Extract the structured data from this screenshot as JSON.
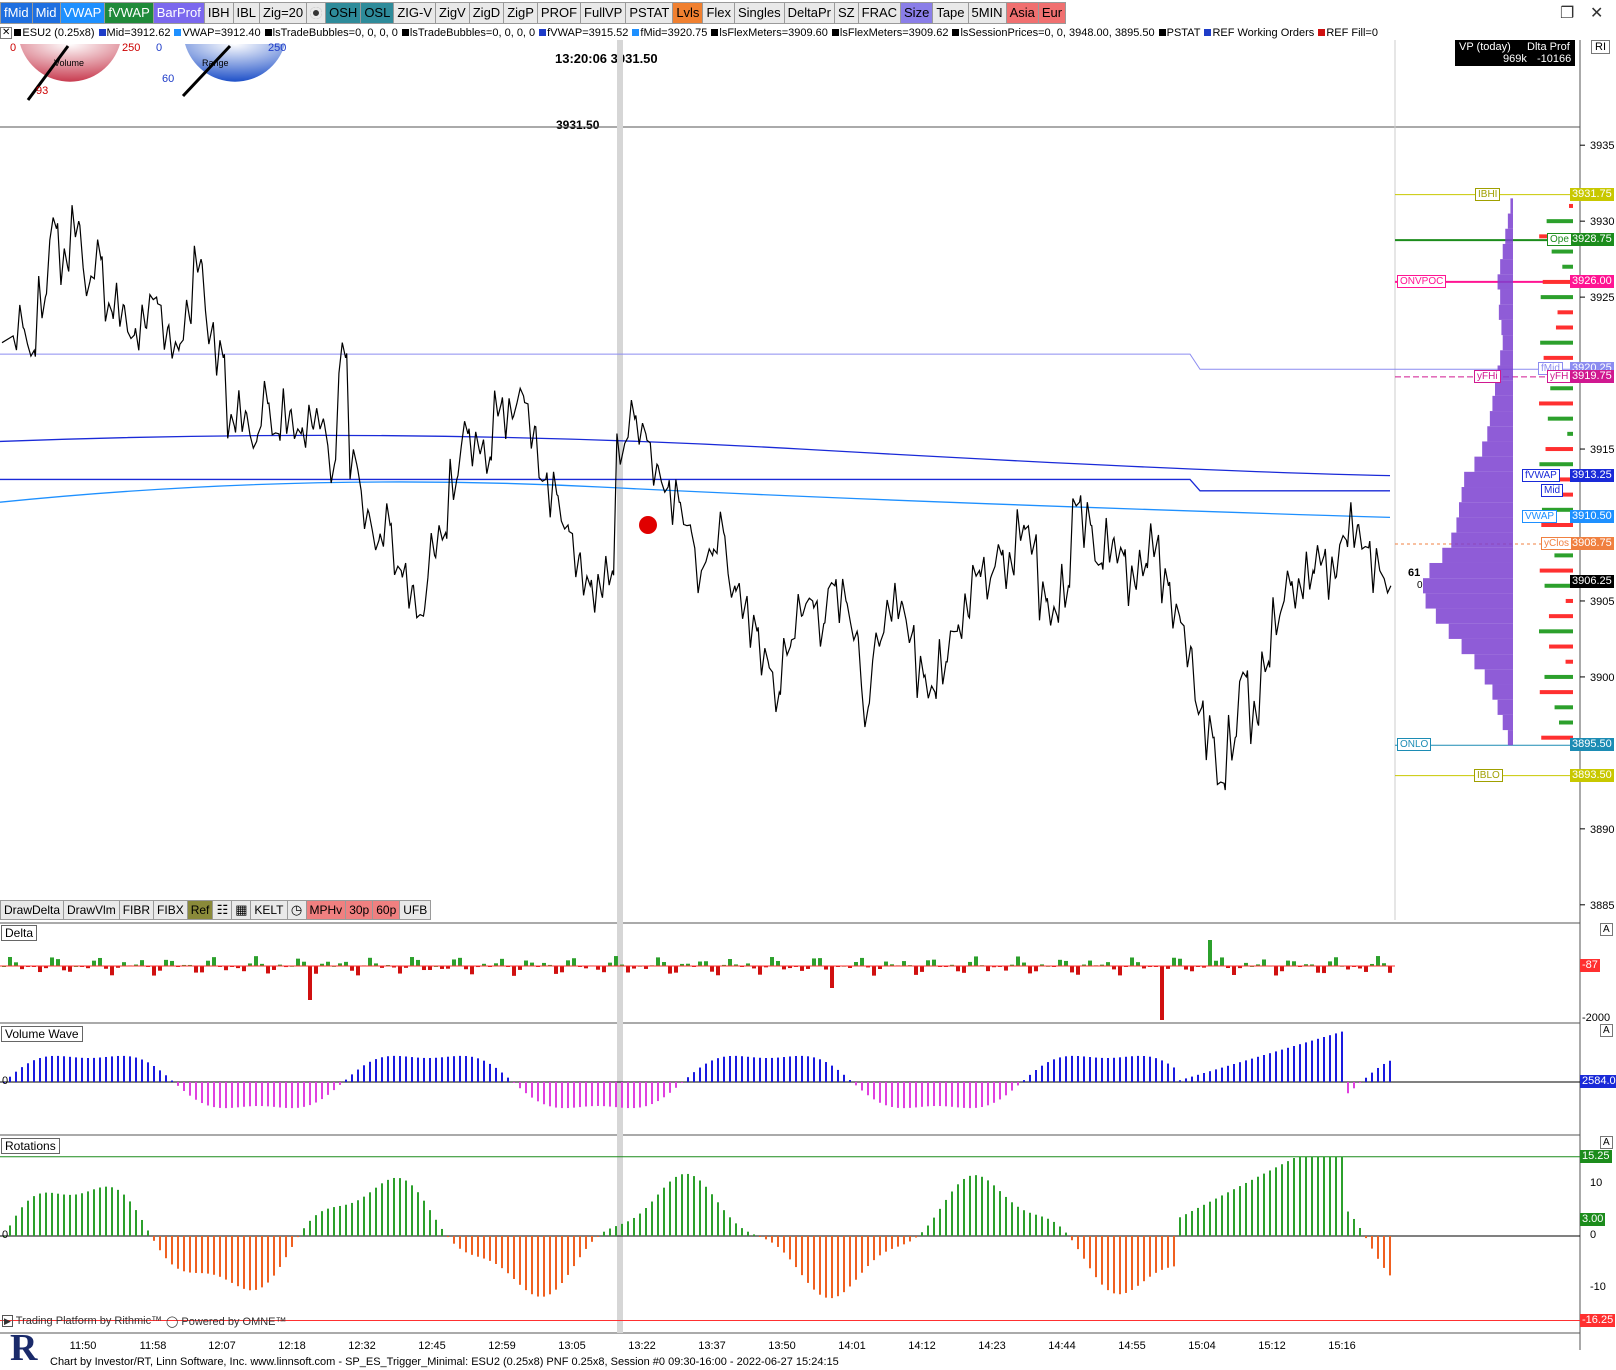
{
  "toolbar": [
    {
      "label": "fMid",
      "bg": "#1e6fe0",
      "fg": "#ffffff"
    },
    {
      "label": "Mid",
      "bg": "#1e6fe0",
      "fg": "#ffffff"
    },
    {
      "label": "VWAP",
      "bg": "#1e90ff",
      "fg": "#ffffff"
    },
    {
      "label": "fVWAP",
      "bg": "#1f8a3a",
      "fg": "#ffffff"
    },
    {
      "label": "BarProf",
      "bg": "#7b68ee",
      "fg": "#ffffff"
    },
    {
      "label": "IBH",
      "bg": "#e9e9e9",
      "fg": "#000000"
    },
    {
      "label": "IBL",
      "bg": "#e9e9e9",
      "fg": "#000000"
    },
    {
      "label": "Zig=20",
      "bg": "#e9e9e9",
      "fg": "#000000"
    },
    {
      "icon": "gear-icon",
      "bg": "#e9e9e9",
      "fg": "#000000"
    },
    {
      "label": "OSH",
      "bg": "#2e8b9a",
      "fg": "#000000"
    },
    {
      "label": "OSL",
      "bg": "#2e8b9a",
      "fg": "#000000"
    },
    {
      "label": "ZIG-V",
      "bg": "#e9e9e9",
      "fg": "#000000"
    },
    {
      "label": "ZigV",
      "bg": "#e9e9e9",
      "fg": "#000000"
    },
    {
      "label": "ZigD",
      "bg": "#e9e9e9",
      "fg": "#000000"
    },
    {
      "label": "ZigP",
      "bg": "#e9e9e9",
      "fg": "#000000"
    },
    {
      "label": "PROF",
      "bg": "#e9e9e9",
      "fg": "#000000"
    },
    {
      "label": "FullVP",
      "bg": "#e9e9e9",
      "fg": "#000000"
    },
    {
      "label": "PSTAT",
      "bg": "#e9e9e9",
      "fg": "#000000"
    },
    {
      "label": "Lvls",
      "bg": "#f08030",
      "fg": "#000000"
    },
    {
      "label": "Flex",
      "bg": "#e9e9e9",
      "fg": "#000000"
    },
    {
      "label": "Singles",
      "bg": "#e9e9e9",
      "fg": "#000000"
    },
    {
      "label": "DeltaPr",
      "bg": "#e9e9e9",
      "fg": "#000000"
    },
    {
      "label": "SZ",
      "bg": "#e9e9e9",
      "fg": "#000000"
    },
    {
      "label": "FRAC",
      "bg": "#e9e9e9",
      "fg": "#000000"
    },
    {
      "label": "Size",
      "bg": "#8a7ee8",
      "fg": "#000000"
    },
    {
      "label": "Tape",
      "bg": "#e9e9e9",
      "fg": "#000000"
    },
    {
      "label": "5MIN",
      "bg": "#e9e9e9",
      "fg": "#000000"
    },
    {
      "label": "Asia",
      "bg": "#f07070",
      "fg": "#000000"
    },
    {
      "label": "Eur",
      "bg": "#f07070",
      "fg": "#000000"
    }
  ],
  "status_items": [
    {
      "text": "ESU2 (0.25x8)",
      "color": "#000000"
    },
    {
      "text": "Mid=3912.62",
      "color": "#1e3cc8"
    },
    {
      "text": "VWAP=3912.40",
      "color": "#1e90ff"
    },
    {
      "text": "lsTradeBubbles=0, 0, 0, 0",
      "color": "#000000"
    },
    {
      "text": "lsTradeBubbles=0, 0, 0, 0",
      "color": "#000000"
    },
    {
      "text": "fVWAP=3915.52",
      "color": "#1e3cc8"
    },
    {
      "text": "fMid=3920.75",
      "color": "#1e90ff"
    },
    {
      "text": "lsFlexMeters=3909.60",
      "color": "#000000"
    },
    {
      "text": "lsFlexMeters=3909.62",
      "color": "#000000"
    },
    {
      "text": "lsSessionPrices=0, 0, 3948.00, 3895.50",
      "color": "#000000"
    },
    {
      "text": "PSTAT",
      "color": "#000000"
    },
    {
      "text": "REF Working Orders",
      "color": "#1e3cc8"
    },
    {
      "text": "REF Fill=0",
      "color": "#d01010"
    }
  ],
  "meters": {
    "volume": {
      "label": "Volume",
      "min": "0",
      "max": "250",
      "value": "93"
    },
    "range": {
      "label": "Range",
      "min": "0",
      "max": "250",
      "value": "60"
    }
  },
  "crosshair": {
    "time_price": "13:20:06  3931.50",
    "price": "3931.50"
  },
  "vp_box": {
    "title1": "VP (today)",
    "title2": "Dlta Prof",
    "value1": "969k",
    "value2": "-10166"
  },
  "ri_label": "RI",
  "price_axis": {
    "min": 3884,
    "max": 3936,
    "ticks": [
      3935,
      3930,
      3925,
      3915,
      3905,
      3900,
      3890,
      3885
    ]
  },
  "price_tags": [
    {
      "text": "3931.75",
      "price": 3931.75,
      "bg": "#c8c800",
      "fg": "#ffffff"
    },
    {
      "text": "3928.75",
      "price": 3928.75,
      "bg": "#1c8c1c",
      "fg": "#ffffff"
    },
    {
      "text": "3926.00",
      "price": 3926.0,
      "bg": "#ff1493",
      "fg": "#ffffff"
    },
    {
      "text": "3920.25",
      "price": 3920.25,
      "bg": "#8c8cf0",
      "fg": "#ffffff"
    },
    {
      "text": "3919.75",
      "price": 3919.75,
      "bg": "#d01890",
      "fg": "#ffffff"
    },
    {
      "text": "3913.25",
      "price": 3913.25,
      "bg": "#1a2ad8",
      "fg": "#ffffff"
    },
    {
      "text": "3910.50",
      "price": 3910.5,
      "bg": "#1e90ff",
      "fg": "#ffffff"
    },
    {
      "text": "3908.75",
      "price": 3908.75,
      "bg": "#f08040",
      "fg": "#ffffff"
    },
    {
      "text": "3906.25",
      "price": 3906.25,
      "bg": "#000000",
      "fg": "#ffffff"
    },
    {
      "text": "3895.50",
      "price": 3895.5,
      "bg": "#1c8cb4",
      "fg": "#ffffff"
    },
    {
      "text": "3893.50",
      "price": 3893.5,
      "bg": "#c8c800",
      "fg": "#ffffff"
    }
  ],
  "level_labels": [
    {
      "text": "IBHI",
      "price": 3931.75,
      "color": "#a0a000",
      "x": 1475
    },
    {
      "text": "Ope",
      "price": 3928.75,
      "color": "#1c8c1c",
      "x": 1547
    },
    {
      "text": "ONVPOC",
      "price": 3926.0,
      "color": "#ff1493",
      "x": 1397
    },
    {
      "text": "fMid",
      "price": 3920.25,
      "color": "#8c8cf0",
      "x": 1538
    },
    {
      "text": "yFHi",
      "price": 3919.75,
      "color": "#d01890",
      "x": 1474
    },
    {
      "text": "yFH",
      "price": 3919.75,
      "color": "#d01890",
      "x": 1547
    },
    {
      "text": "fVWAP",
      "price": 3913.25,
      "color": "#1a2ad8",
      "x": 1522
    },
    {
      "text": "Mid",
      "price": 3912.25,
      "color": "#1a2ad8",
      "x": 1541
    },
    {
      "text": "VWAP",
      "price": 3910.5,
      "color": "#1e90ff",
      "x": 1522
    },
    {
      "text": "yClos",
      "price": 3908.75,
      "color": "#f08040",
      "x": 1541
    },
    {
      "text": "ONLO",
      "price": 3895.5,
      "color": "#1c8cb4",
      "x": 1397
    },
    {
      "text": "IBLO",
      "price": 3893.5,
      "color": "#a0a000",
      "x": 1474
    }
  ],
  "chart_note": {
    "value": "61",
    "sub": "0"
  },
  "bottom_toolbar": [
    {
      "label": "DrawDelta",
      "bg": "#e9e9e9"
    },
    {
      "label": "DrawVlm",
      "bg": "#e9e9e9"
    },
    {
      "label": "FIBR",
      "bg": "#e9e9e9"
    },
    {
      "label": "FIBX",
      "bg": "#e9e9e9"
    },
    {
      "label": "Ref",
      "bg": "#8a8a3a"
    },
    {
      "icon": "sliders-icon",
      "bg": "#e9e9e9"
    },
    {
      "icon": "calculator-icon",
      "bg": "#e9e9e9"
    },
    {
      "label": "KELT",
      "bg": "#e9e9e9"
    },
    {
      "icon": "clock-icon",
      "bg": "#e9e9e9"
    },
    {
      "label": "MPHv",
      "bg": "#f08080"
    },
    {
      "label": "30p",
      "bg": "#f08080"
    },
    {
      "label": "60p",
      "bg": "#f08080"
    },
    {
      "label": "UFB",
      "bg": "#e9e9e9"
    }
  ],
  "panels": {
    "delta": {
      "title": "Delta",
      "scale_tag": "-87",
      "scale_low": "-2000",
      "scale_btn": "A"
    },
    "volume_wave": {
      "title": "Volume Wave",
      "scale_tag": "2584.00",
      "zero": "0",
      "scale_btn": "A"
    },
    "rotations": {
      "title": "Rotations",
      "tag_high": "15.25",
      "tag_mid": "3.00",
      "tag_low": "-16.25",
      "tick_10": "10",
      "tick_0": "0",
      "tick_m10": "-10",
      "zero": "0",
      "scale_btn": "A"
    }
  },
  "time_axis": [
    {
      "label": "11:50",
      "x": 83
    },
    {
      "label": "11:58",
      "x": 153
    },
    {
      "label": "12:07",
      "x": 222
    },
    {
      "label": "12:18",
      "x": 292
    },
    {
      "label": "12:32",
      "x": 362
    },
    {
      "label": "12:45",
      "x": 432
    },
    {
      "label": "12:59",
      "x": 502
    },
    {
      "label": "13:05",
      "x": 572
    },
    {
      "label": "13:22",
      "x": 642
    },
    {
      "label": "13:37",
      "x": 712
    },
    {
      "label": "13:50",
      "x": 782
    },
    {
      "label": "14:01",
      "x": 852
    },
    {
      "label": "14:12",
      "x": 922
    },
    {
      "label": "14:23",
      "x": 992
    },
    {
      "label": "14:44",
      "x": 1062
    },
    {
      "label": "14:55",
      "x": 1132
    },
    {
      "label": "15:04",
      "x": 1202
    },
    {
      "label": "15:12",
      "x": 1272
    },
    {
      "label": "15:16",
      "x": 1342
    }
  ],
  "footer": {
    "trading_platform": "Trading Platform by Rithmic™",
    "powered_by": "Powered by OMNE™",
    "chart_info": "Chart by Investor/RT, Linn Software, Inc. www.linnsoft.com - SP_ES_Trigger_Minimal: ESU2 (0.25x8) PNF 0.25x8, Session #0 09:30-16:00 - 2022-06-27 15:24:15",
    "logo_letter": "R"
  },
  "chart_data": {
    "type": "line",
    "instrument": "ESU2 (0.25x8)",
    "series": [
      {
        "values": [
          3922,
          3923,
          3921.5,
          3925,
          3929.5,
          3927,
          3930,
          3926,
          3927.5,
          3924,
          3924.5,
          3922.5,
          3923,
          3925,
          3923,
          3921.5,
          3923.5,
          3927.5,
          3923,
          3921,
          3916.5,
          3917.5,
          3915.5,
          3918,
          3916,
          3917.5,
          3916,
          3916.5,
          3917,
          3914,
          3921,
          3914,
          3911,
          3909,
          3910,
          3907,
          3906,
          3904,
          3908,
          3909.5,
          3913,
          3916,
          3915,
          3914.5,
          3918,
          3917,
          3918.5,
          3916.5,
          3913,
          3912,
          3910,
          3908,
          3906,
          3905.5,
          3907,
          3915,
          3917,
          3916,
          3914,
          3912.5,
          3911.5,
          3910,
          3907,
          3908,
          3909.5,
          3906,
          3905,
          3903,
          3901,
          3899,
          3902,
          3904,
          3905,
          3903.5,
          3906,
          3905,
          3903,
          3898,
          3902,
          3904,
          3905,
          3903,
          3900,
          3899,
          3901,
          3903,
          3904,
          3907,
          3906.5,
          3908,
          3907,
          3910,
          3909,
          3905,
          3904,
          3906,
          3911.5,
          3910,
          3907.5,
          3909,
          3908,
          3906,
          3907.5,
          3909,
          3906,
          3904,
          3902,
          3898,
          3896,
          3893,
          3896,
          3900,
          3897,
          3901,
          3904,
          3906,
          3905.5,
          3907,
          3908,
          3906.5,
          3909,
          3910,
          3908.5,
          3907,
          3906
        ],
        "color": "#000000"
      }
    ],
    "levels": {
      "IBHI": 3931.75,
      "Open": 3928.75,
      "ONVPOC": 3926.0,
      "fMid": 3920.25,
      "yFHi": 3919.75,
      "fVWAP": 3913.25,
      "Mid": 3912.25,
      "VWAP": 3910.5,
      "yClose": 3908.75,
      "Last": 3906.25,
      "ONLO": 3895.5,
      "IBLO": 3893.5
    },
    "ylim": [
      3884,
      3936
    ],
    "volume_profile": {
      "prices": [
        3931,
        3930,
        3929,
        3928,
        3927,
        3926,
        3925,
        3924,
        3923,
        3922,
        3921,
        3920,
        3919,
        3918,
        3917,
        3916,
        3915,
        3914,
        3913,
        3912,
        3911,
        3910,
        3909,
        3908,
        3907,
        3906,
        3905,
        3904,
        3903,
        3902,
        3901,
        3900,
        3899,
        3898,
        3897,
        3896
      ],
      "values": [
        2,
        4,
        6,
        8,
        10,
        12,
        10,
        11,
        9,
        8,
        10,
        12,
        14,
        16,
        18,
        20,
        24,
        30,
        38,
        40,
        42,
        44,
        48,
        55,
        65,
        70,
        68,
        60,
        50,
        40,
        30,
        22,
        16,
        12,
        8,
        4
      ]
    }
  }
}
